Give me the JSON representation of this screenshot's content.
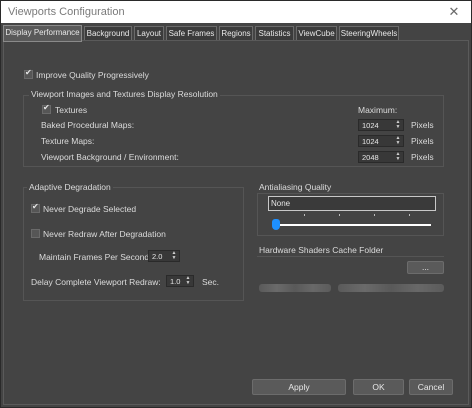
{
  "window": {
    "title": "Viewports Configuration",
    "close_glyph": "✕"
  },
  "tabs": [
    {
      "label": "Display Performance",
      "active": true
    },
    {
      "label": "Background",
      "active": false
    },
    {
      "label": "Layout",
      "active": false
    },
    {
      "label": "Safe Frames",
      "active": false
    },
    {
      "label": "Regions",
      "active": false
    },
    {
      "label": "Statistics",
      "active": false
    },
    {
      "label": "ViewCube",
      "active": false
    },
    {
      "label": "SteeringWheels",
      "active": false
    }
  ],
  "improve_quality": {
    "label": "Improve Quality Progressively",
    "checked": true
  },
  "textures_group": {
    "title": "Viewport Images and Textures Display Resolution",
    "textures": {
      "label": "Textures",
      "checked": true
    },
    "maximum_label": "Maximum:",
    "rows": [
      {
        "label": "Baked Procedural Maps:",
        "value": "1024",
        "unit": "Pixels"
      },
      {
        "label": "Texture Maps:",
        "value": "1024",
        "unit": "Pixels"
      },
      {
        "label": "Viewport Background / Environment:",
        "value": "2048",
        "unit": "Pixels"
      }
    ]
  },
  "adaptive": {
    "title": "Adaptive Degradation",
    "never_degrade": {
      "label": "Never Degrade Selected",
      "checked": true
    },
    "never_redraw": {
      "label": "Never Redraw After Degradation",
      "checked": false
    },
    "fps_label": "Maintain Frames Per Second:",
    "fps_value": "2.0",
    "delay_label": "Delay Complete Viewport Redraw:",
    "delay_value": "1.0",
    "delay_unit": "Sec."
  },
  "antialiasing": {
    "title": "Antialiasing Quality",
    "value": "None",
    "slider_level": 0
  },
  "hw_cache": {
    "title": "Hardware Shaders Cache Folder",
    "browse_label": "..."
  },
  "buttons": {
    "apply": "Apply",
    "ok": "OK",
    "cancel": "Cancel"
  },
  "colors": {
    "background": "#444444",
    "accent": "#1e90ff",
    "titlebar": "#ffffff"
  },
  "icons": {
    "close": "close-icon",
    "checkbox": "check-icon",
    "spinner": "spinner-arrows-icon"
  }
}
